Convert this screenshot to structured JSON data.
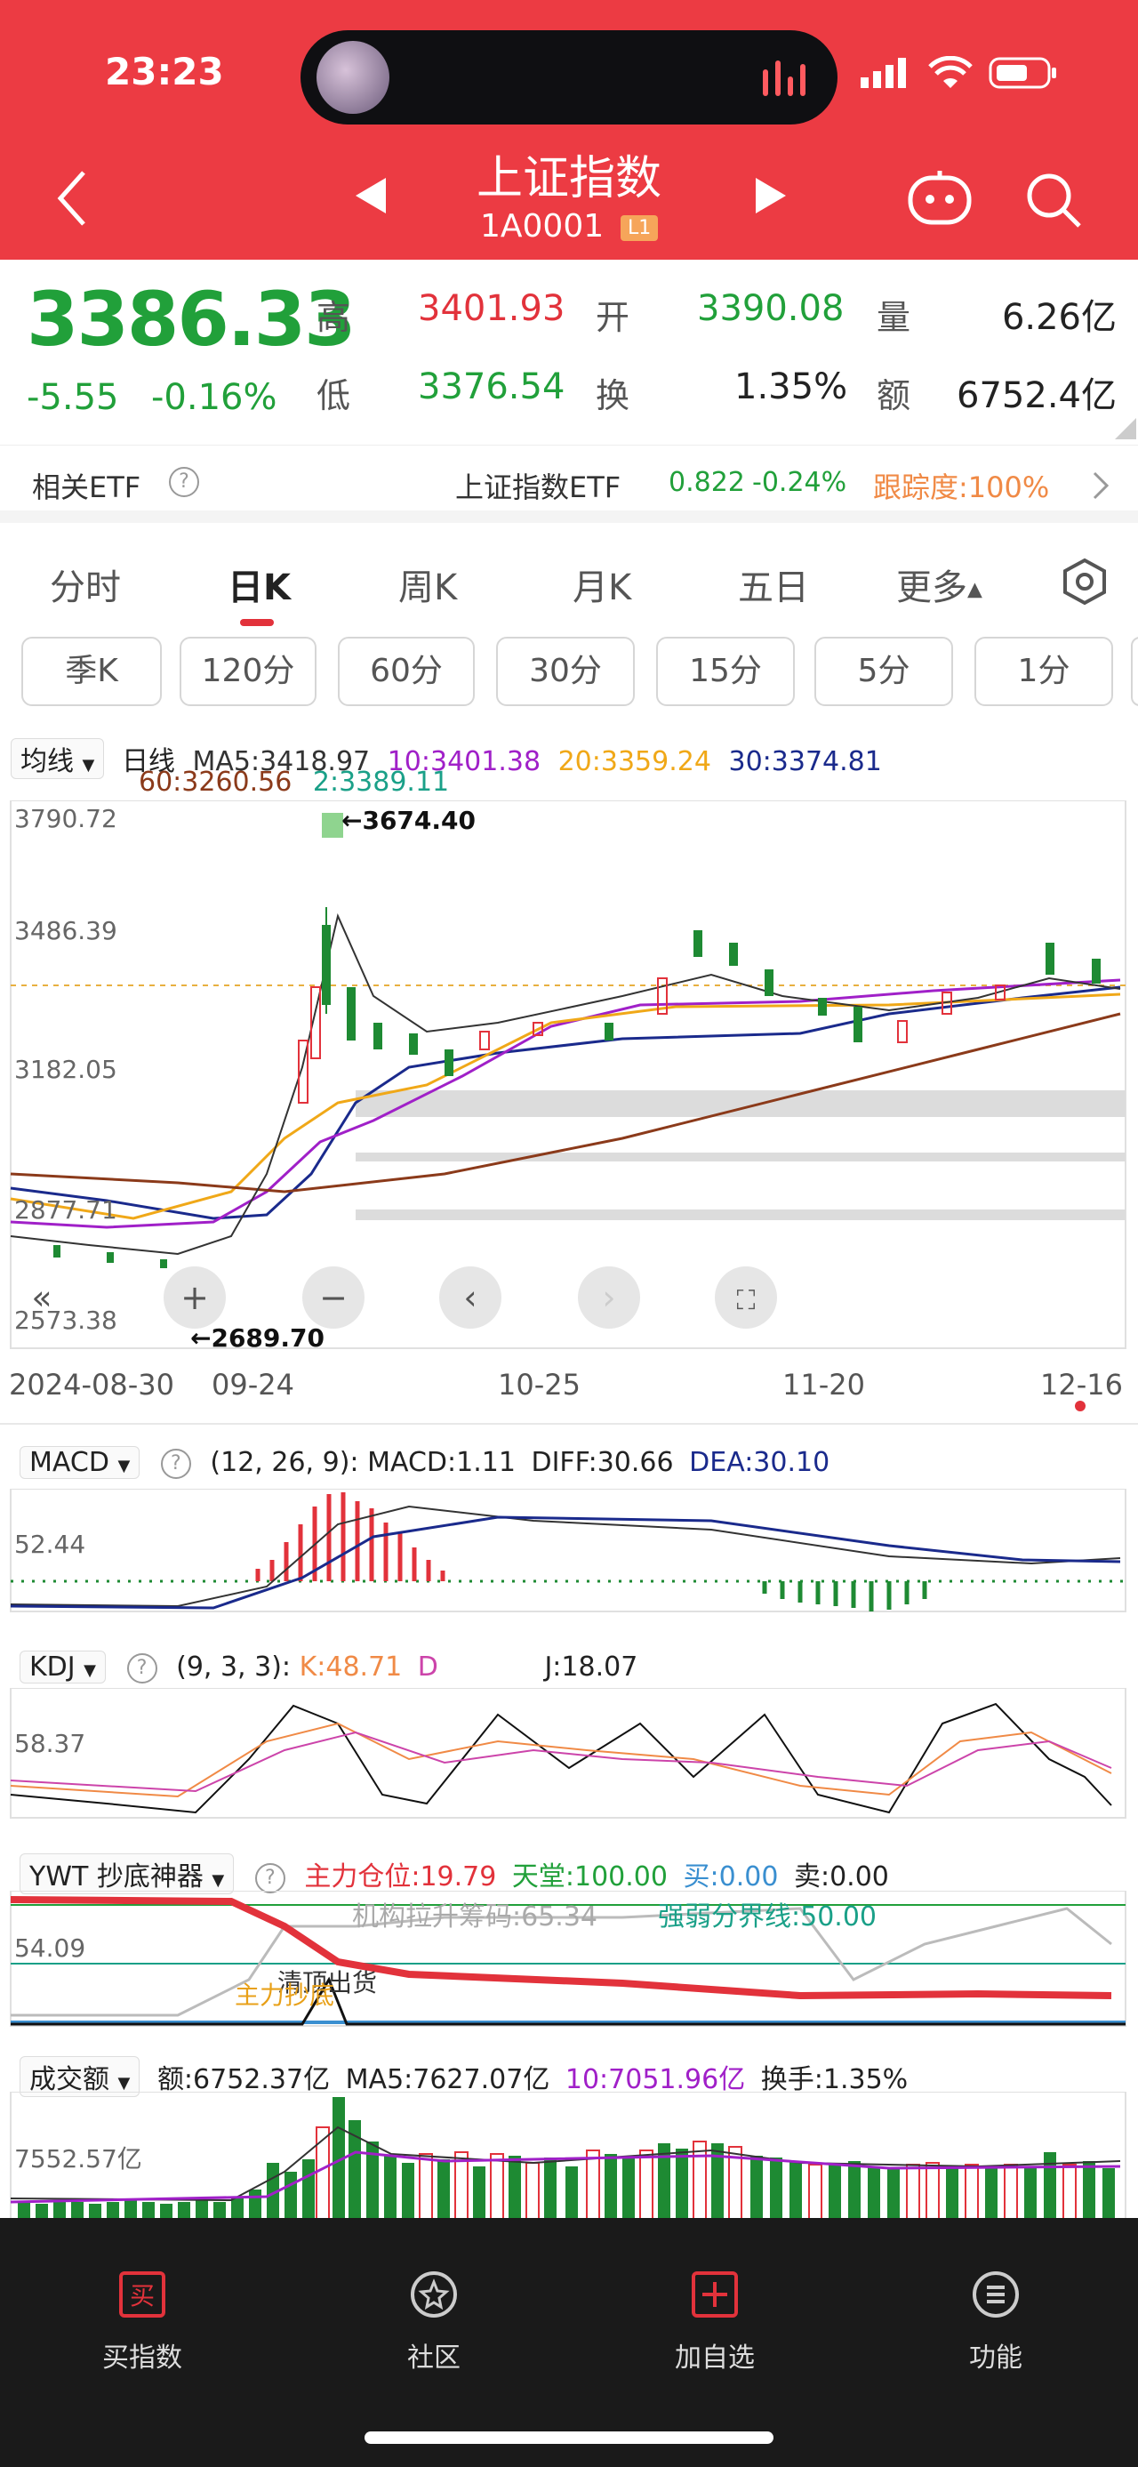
{
  "status_bar": {
    "time": "23:23"
  },
  "header": {
    "title": "上证指数",
    "code": "1A0001",
    "level_badge": "L1"
  },
  "quote": {
    "price": "3386.33",
    "change": "-5.55",
    "change_pct": "-0.16%",
    "high_label": "高",
    "high": "3401.93",
    "open_label": "开",
    "open": "3390.08",
    "volume_label": "量",
    "volume": "6.26亿",
    "low_label": "低",
    "low": "3376.54",
    "turnover_label": "换",
    "turnover": "1.35%",
    "amount_label": "额",
    "amount": "6752.4亿"
  },
  "etf": {
    "label": "相关ETF",
    "name": "上证指数ETF",
    "price": "0.822",
    "change": "-0.24%",
    "tracking": "跟踪度:100%"
  },
  "tabs": [
    "分时",
    "日K",
    "周K",
    "月K",
    "五日",
    "更多"
  ],
  "periods": [
    "季K",
    "120分",
    "60分",
    "30分",
    "15分",
    "5分",
    "1分"
  ],
  "kline": {
    "ma_selector": "均线",
    "period_label": "日线",
    "ma5": "MA5:3418.97",
    "ma10": "10:3401.38",
    "ma20": "20:3359.24",
    "ma30": "30:3374.81",
    "ma60": "60:3260.56",
    "ma2": "2:3389.11",
    "y_ticks": [
      "3790.72",
      "3486.39",
      "3182.05",
      "2877.71",
      "2573.38"
    ],
    "high_mark": "←3674.40",
    "low_mark": "←2689.70",
    "dates": [
      "2024-08-30",
      "09-24",
      "10-25",
      "11-20",
      "12-16"
    ],
    "nine_label": "9"
  },
  "macd": {
    "name": "MACD",
    "params": "(12, 26, 9):",
    "macd": "MACD:1.11",
    "diff": "DIFF:30.66",
    "dea": "DEA:30.10",
    "y_tick": "52.44"
  },
  "kdj": {
    "name": "KDJ",
    "params": "(9, 3, 3):",
    "k": "K:48.71",
    "d": "D",
    "j": "J:18.07",
    "y_tick": "58.37"
  },
  "ywt": {
    "name": "YWT 抄底神器",
    "main": "主力仓位:19.79",
    "heaven": "天堂:100.00",
    "buy": "买:0.00",
    "sell": "卖:0.00",
    "inst": "机构拉升筹码:65.34",
    "boundary": "强弱分界线:50.00",
    "y_tick": "54.09",
    "tag_top": "清顶出货",
    "tag_main": "主力抄底"
  },
  "volume": {
    "name": "成交额",
    "amount": "额:6752.37亿",
    "ma5": "MA5:7627.07亿",
    "ma10": "10:7051.96亿",
    "turnover": "换手:1.35%",
    "y_tick": "7552.57亿"
  },
  "bottom_nav": [
    "买指数",
    "社区",
    "加自选",
    "功能"
  ],
  "colors": {
    "header": "#ec3b43",
    "up": "#e2323b",
    "down": "#1e8a33",
    "ma5": "#333333",
    "ma10": "#a020c8",
    "ma20": "#f0a818",
    "ma30": "#1a2a8c",
    "ma60": "#8b3a1a",
    "ma2": "#1aa088"
  }
}
